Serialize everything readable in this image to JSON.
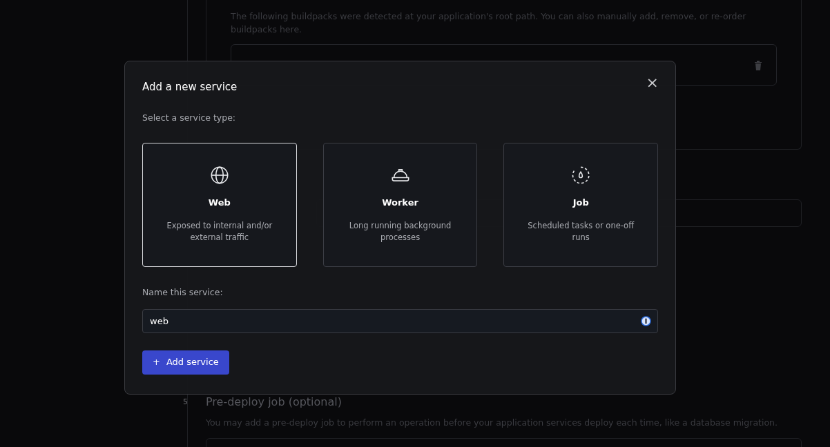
{
  "background": {
    "buildpacks_description": "The following buildpacks were detected at your application's root path. You can also manually add, remove, or re-order buildpacks here.",
    "step": {
      "number": "5",
      "title": "Pre-deploy job (optional)",
      "description": "You may add a pre-deploy job to perform an operation before your application services deploy each time, like a database migration."
    }
  },
  "modal": {
    "title": "Add a new service",
    "close": "×",
    "type_label": "Select a service type:",
    "service_types": [
      {
        "kind": "web",
        "name": "Web",
        "description": "Exposed to internal and/or external traffic",
        "selected": true
      },
      {
        "kind": "worker",
        "name": "Worker",
        "description": "Long running background processes",
        "selected": false
      },
      {
        "kind": "job",
        "name": "Job",
        "description": "Scheduled tasks or one-off runs",
        "selected": false
      }
    ],
    "name_label": "Name this service:",
    "name_value": "web",
    "submit_icon": "+",
    "submit": "Add service"
  }
}
